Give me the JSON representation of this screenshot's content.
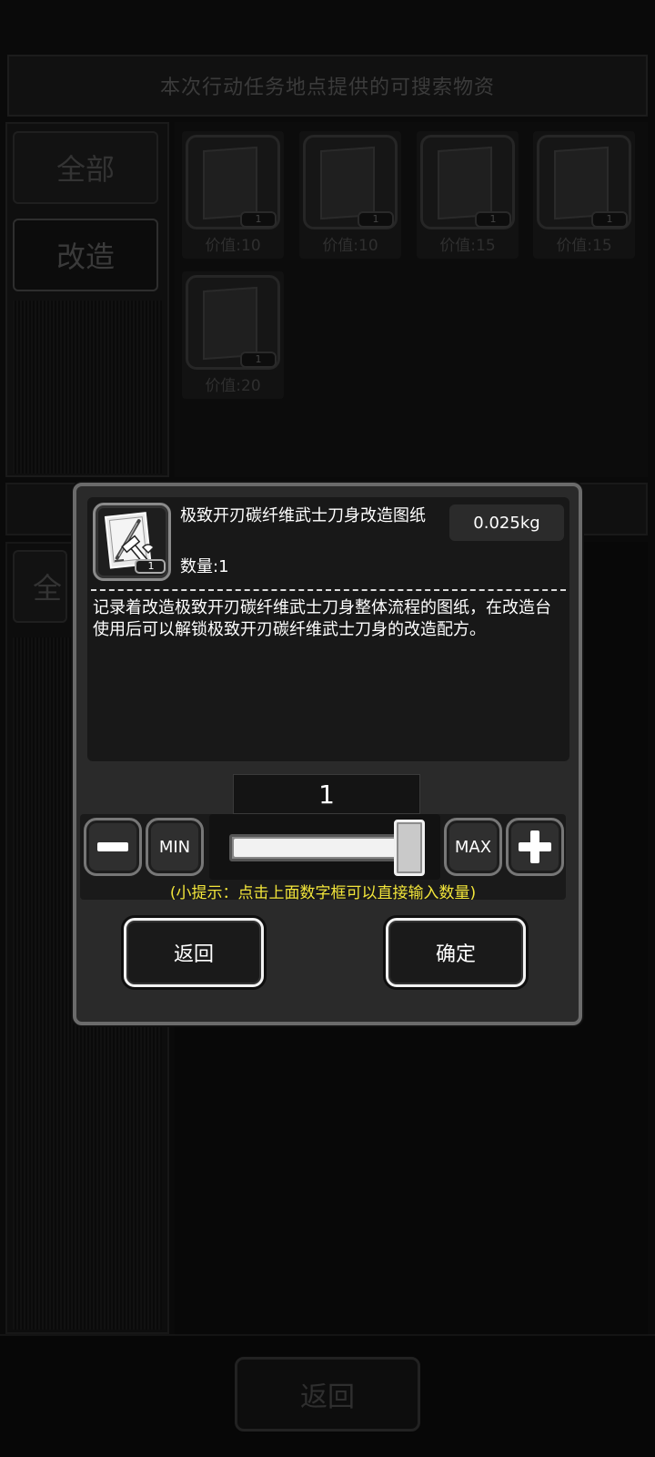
{
  "background": {
    "title": "本次行动任务地点提供的可搜索物资",
    "tabs": [
      {
        "label": "全部"
      },
      {
        "label": "改造"
      }
    ],
    "lower_tab_partial": "全",
    "items": [
      {
        "value": "价值:10",
        "qty": "1"
      },
      {
        "value": "价值:10",
        "qty": "1"
      },
      {
        "value": "价值:15",
        "qty": "1"
      },
      {
        "value": "价值:15",
        "qty": "1"
      },
      {
        "value": "价值:20",
        "qty": "1"
      }
    ],
    "back_label": "返回"
  },
  "dialog": {
    "item": {
      "title": "极致开刃碳纤维武士刀身改造图纸",
      "count": "数量:1",
      "weight": "0.025kg",
      "icon_qty": "1",
      "icon": "blueprint-wrench-icon",
      "description": "记录着改造极致开刃碳纤维武士刀身整体流程的图纸，在改造台使用后可以解锁极致开刃碳纤维武士刀身的改造配方。"
    },
    "quantity": "1",
    "slider_level": 1.0,
    "min_label": "MIN",
    "max_label": "MAX",
    "hint": "(小提示：点击上面数字框可以直接输入数量)",
    "cancel_label": "返回",
    "confirm_label": "确定"
  },
  "colors": {
    "hint": "#f2e53a",
    "dialog_border": "#6b6b6b"
  }
}
